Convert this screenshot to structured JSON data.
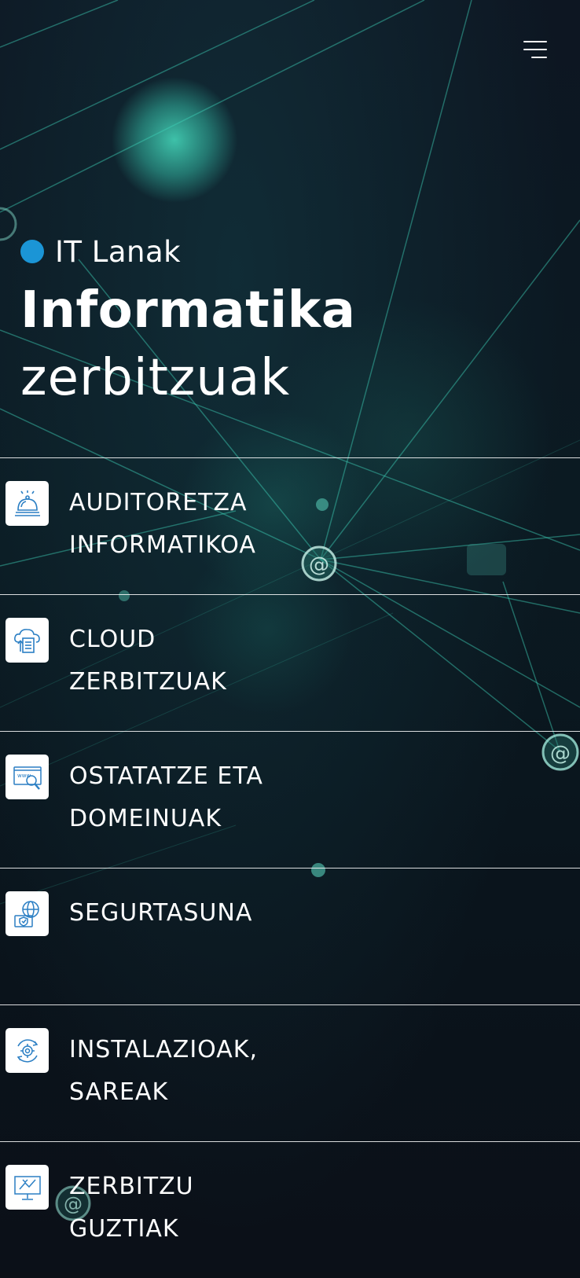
{
  "header": {
    "menu_icon": "hamburger-menu-icon"
  },
  "hero": {
    "tag_label": "IT Lanak",
    "tag_dot_color": "#1b95d6",
    "title_bold": "Informatika",
    "title_light": "zerbitzuak"
  },
  "services": {
    "items": [
      {
        "line1": "AUDITORETZA",
        "line2": "INFORMATIKOA",
        "icon": "reception-bell-icon"
      },
      {
        "line1": "CLOUD",
        "line2": "ZERBITZUAK",
        "icon": "cloud-document-icon"
      },
      {
        "line1": "OSTATATZE ETA",
        "line2": "DOMEINUAK",
        "icon": "www-search-icon"
      },
      {
        "line1": "SEGURTASUNA",
        "line2": "",
        "icon": "globe-shield-icon"
      },
      {
        "line1": "INSTALAZIOAK,",
        "line2": "SAREAK",
        "icon": "gear-refresh-icon"
      },
      {
        "line1": "ZERBITZU",
        "line2": "GUZTIAK",
        "icon": "presentation-board-icon"
      }
    ]
  }
}
